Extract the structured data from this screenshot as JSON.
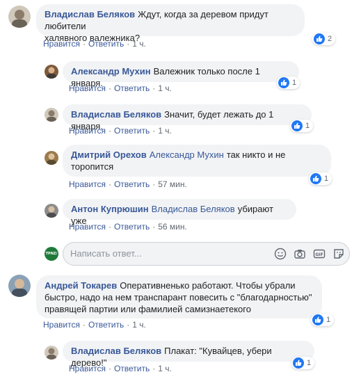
{
  "comments": [
    {
      "author": "Владислав Беляков",
      "text_line1": "Ждут, когда за деревом придут любители",
      "text_line2": "халявного валежника?",
      "like": "Нравится",
      "reply": "Ответить",
      "time": "1 ч.",
      "reactions": "2"
    },
    {
      "author": "Александр Мухин",
      "text": "Валежник только после 1 января.",
      "like": "Нравится",
      "reply": "Ответить",
      "time": "1 ч.",
      "reactions": "1"
    },
    {
      "author": "Владислав Беляков",
      "text": "Значит, будет лежать до 1 января.",
      "like": "Нравится",
      "reply": "Ответить",
      "time": "1 ч.",
      "reactions": "1"
    },
    {
      "author": "Дмитрий Орехов",
      "mention": "Александр Мухин",
      "text_line1": "так никто и не",
      "text_line2": "торопится",
      "like": "Нравится",
      "reply": "Ответить",
      "time": "57 мин.",
      "reactions": "1"
    },
    {
      "author": "Антон Купрюшин",
      "mention": "Владислав Беляков",
      "text": "убирают уже",
      "like": "Нравится",
      "reply": "Ответить",
      "time": "56 мин."
    },
    {
      "author": "Андрей Токарев",
      "text_line1": "Оперативненько работают. Чтобы убрали",
      "text_line2": "быстро, надо на нем транспарант повесить с \"благодарностью\"",
      "text_line3": "правящей партии или фамилией самизнаетекого",
      "like": "Нравится",
      "reply": "Ответить",
      "time": "1 ч.",
      "reactions": "1"
    },
    {
      "author": "Владислав Беляков",
      "text": "Плакат: \"Кувайцев, убери дерево!\"",
      "like": "Нравится",
      "reply": "Ответить",
      "time": "1 ч.",
      "reactions": "1"
    }
  ],
  "reply_box": {
    "placeholder": "Написать ответ...",
    "avatar_text": "TPNZ/"
  },
  "icons": {
    "like": "thumbs-up-icon",
    "emoji": "smiley-icon",
    "camera": "camera-icon",
    "gif": "gif-icon",
    "sticker": "sticker-icon"
  },
  "colors": {
    "link": "#385898",
    "bubble": "#f2f3f5",
    "like_blue": "#2078f4",
    "meta": "#606770"
  }
}
